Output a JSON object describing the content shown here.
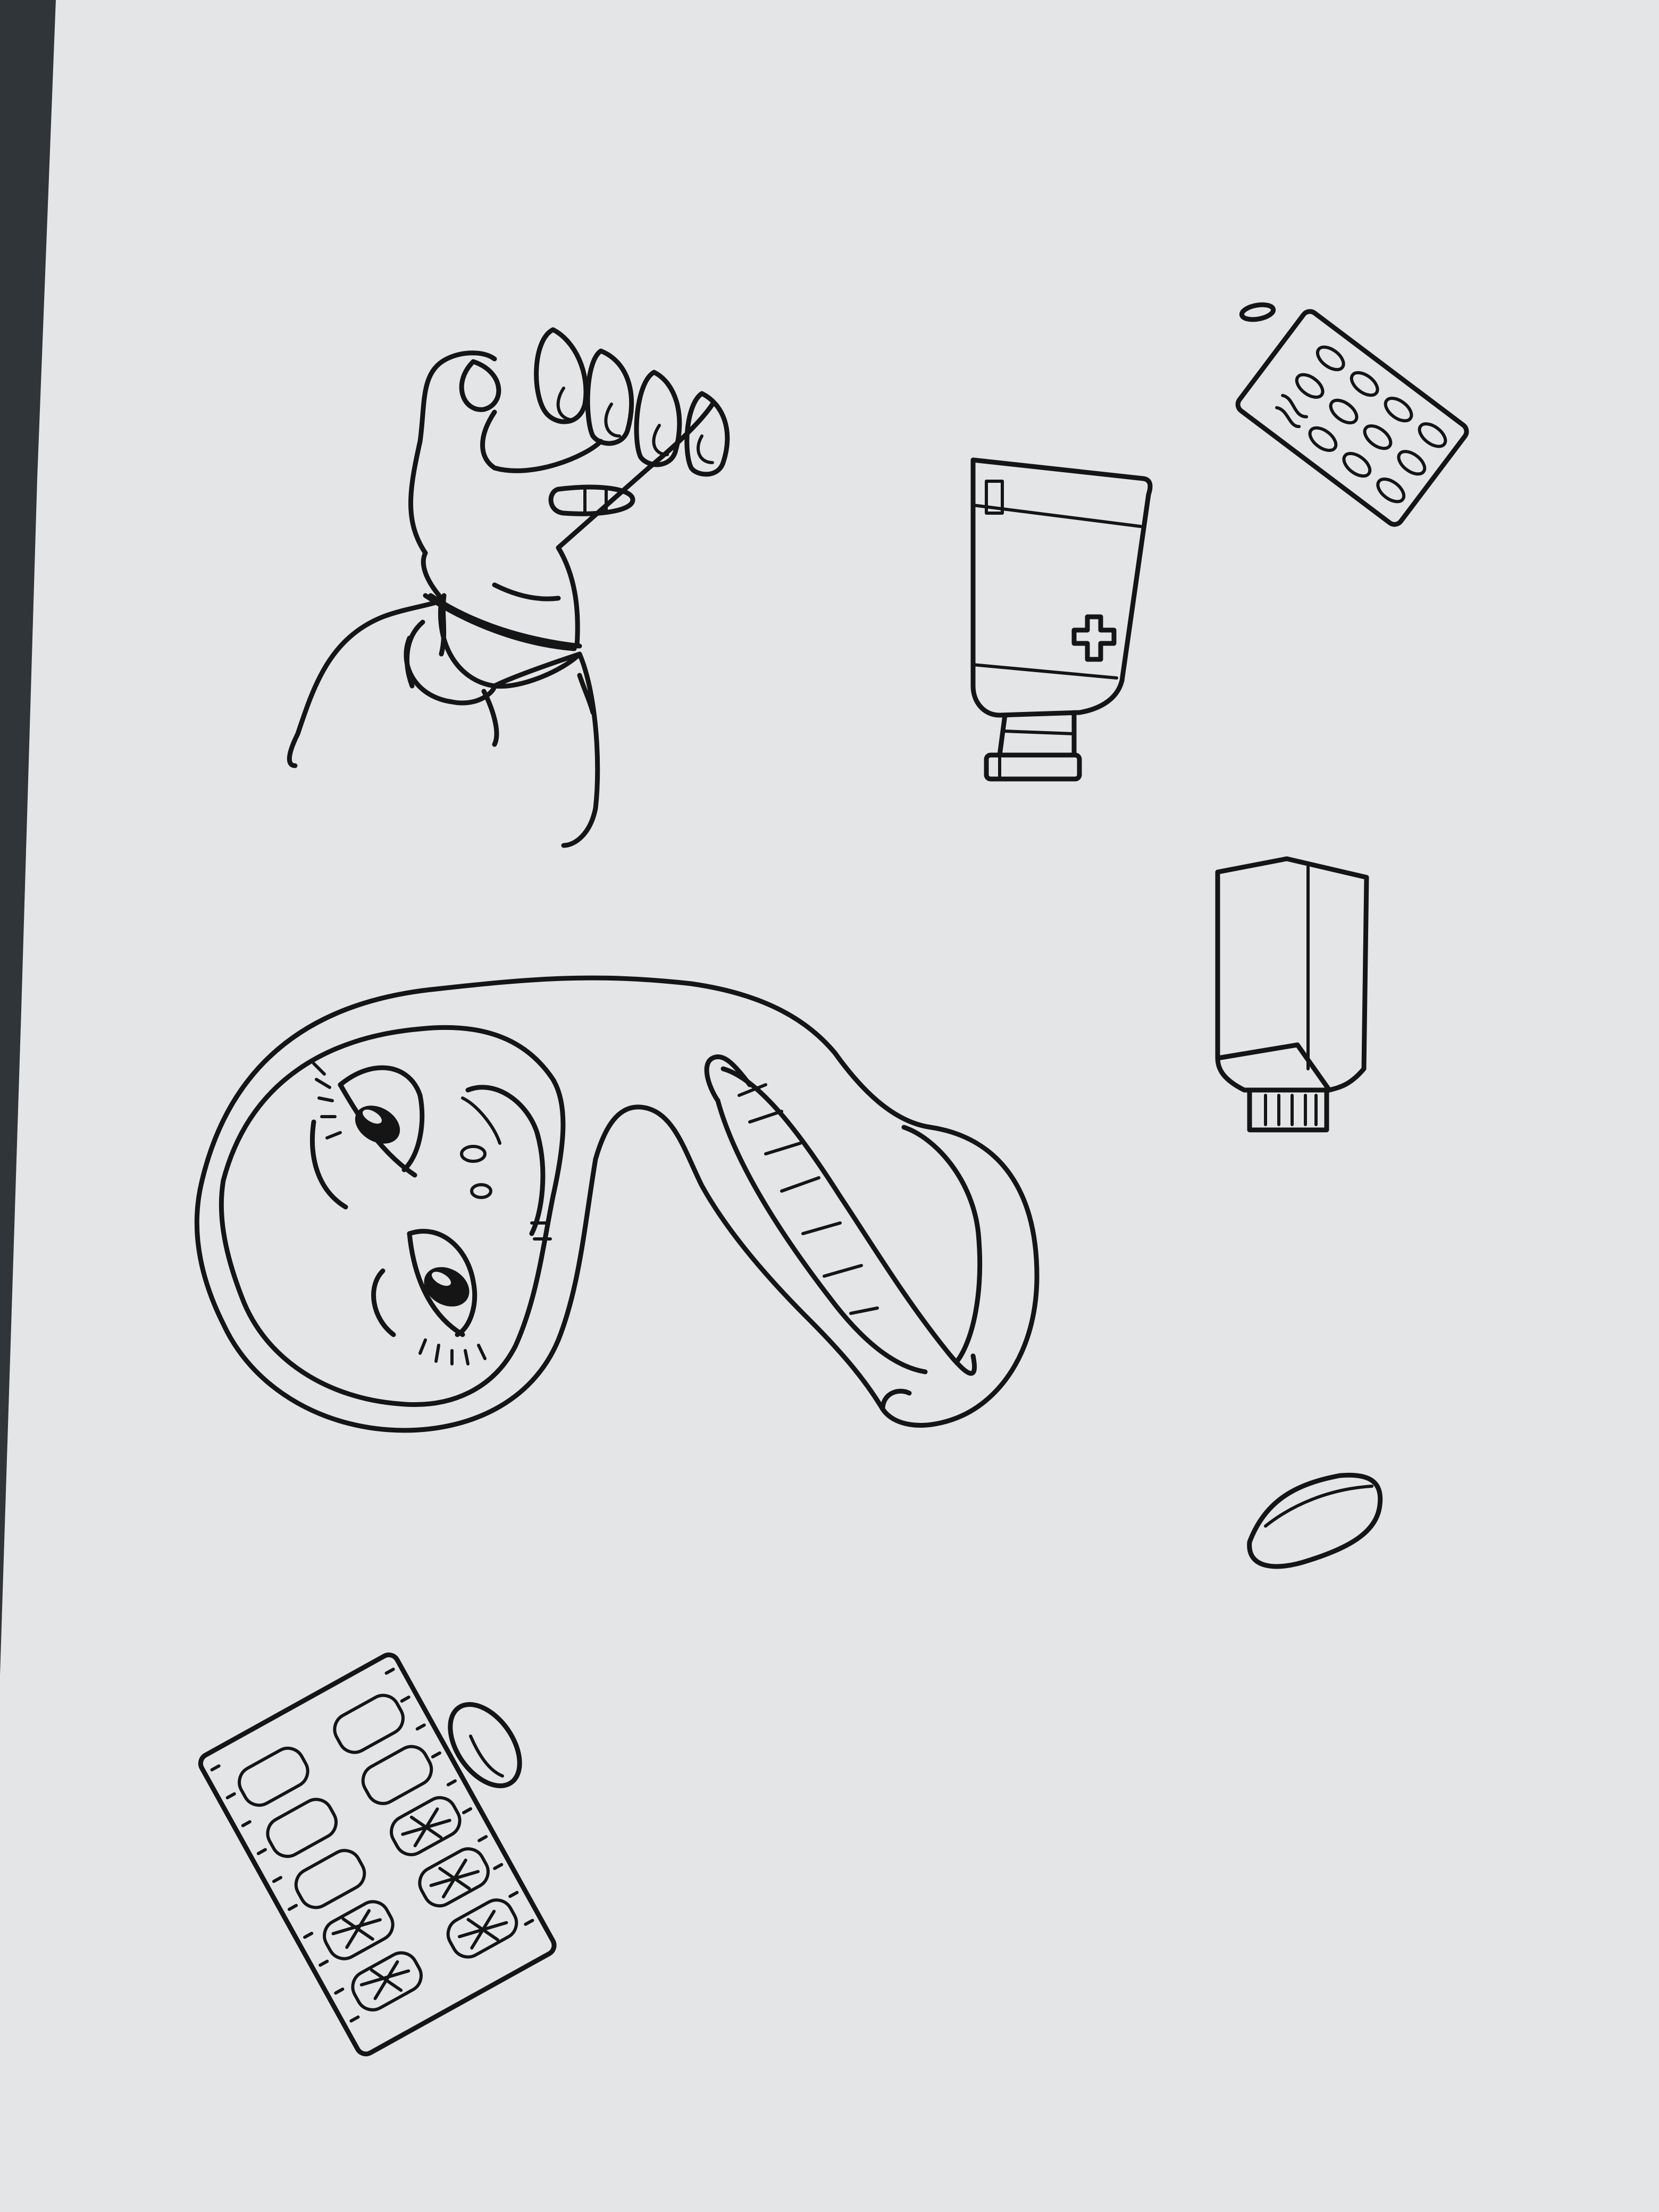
{
  "scene": {
    "background_color": "#2f3538",
    "paper_color": "#e4e5e7",
    "ink_color": "#151515"
  },
  "drawings": [
    {
      "name": "gloved-hand",
      "icon": "gloved-hand-icon"
    },
    {
      "name": "blister-pack-small",
      "icon": "blister-pack-icon"
    },
    {
      "name": "capsule-small",
      "icon": "capsule-icon"
    },
    {
      "name": "medicine-tube",
      "icon": "medicine-tube-icon"
    },
    {
      "name": "folded-tube",
      "icon": "folded-tube-icon"
    },
    {
      "name": "stomach-with-face",
      "icon": "stomach-face-icon"
    },
    {
      "name": "tablet",
      "icon": "tablet-icon"
    },
    {
      "name": "blister-pack-large",
      "icon": "blister-pack-icon"
    },
    {
      "name": "capsule",
      "icon": "capsule-icon"
    }
  ]
}
